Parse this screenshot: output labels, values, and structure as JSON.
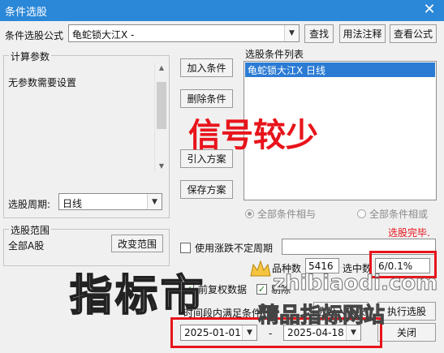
{
  "window": {
    "title": "条件选股",
    "close_glyph": "✕"
  },
  "formula": {
    "label": "条件选股公式",
    "value": "龟蛇锁大江X  -",
    "buttons": {
      "find": "查找",
      "usage": "用法注释",
      "view": "查看公式"
    }
  },
  "params": {
    "group_label": "计算参数",
    "text": "无参数需要设置",
    "period_label": "选股周期:",
    "period_value": "日线"
  },
  "actions": {
    "add": "加入条件",
    "remove": "删除条件",
    "import": "引入方案",
    "save": "保存方案"
  },
  "conditions": {
    "label": "选股条件列表",
    "items": [
      "龟蛇锁大江X  日线"
    ],
    "radio_and": "全部条件相与",
    "radio_or": "全部条件相或",
    "status": "选股完毕."
  },
  "range": {
    "group_label": "选股范围",
    "value": "全部A股",
    "change_button": "改变范围"
  },
  "options": {
    "volatile_period": "使用涨跌不定周期",
    "pre_rights": "前复权数据",
    "other_check": "剔除"
  },
  "stats": {
    "count_label": "品种数",
    "count_value": "5416",
    "hit_label": "选中数",
    "hit_value": "6/0.1%"
  },
  "period": {
    "label": "时间段内满足条件",
    "start": "2025-01-01",
    "dash": "-",
    "end": "2025-04-18"
  },
  "footer": {
    "to_block": "选股入板块",
    "run": "执行选股",
    "close": "关闭"
  },
  "overlays": {
    "signal_caption": "信号较少",
    "watermark_big": "指标市",
    "watermark_site": "zhibiaodi.com",
    "watermark_tail": "精品指标网站"
  },
  "colors": {
    "title_bar": "#2b87d7",
    "selection": "#2b7bd4",
    "highlight": "#e8141b",
    "status": "#e8141b"
  }
}
